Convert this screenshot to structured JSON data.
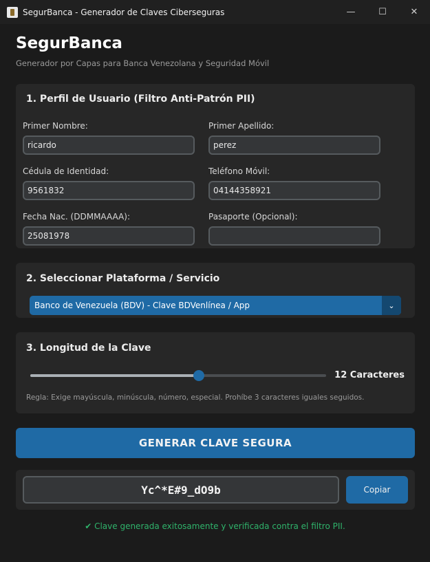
{
  "window": {
    "title": "SegurBanca - Generador de Claves Ciberseguras",
    "minimize_glyph": "—",
    "maximize_glyph": "☐",
    "close_glyph": "✕"
  },
  "header": {
    "title": "SegurBanca",
    "subtitle": "Generador por Capas para Banca Venezolana y Seguridad Móvil"
  },
  "profile": {
    "title": "1. Perfil de Usuario (Filtro Anti-Patrón PII)",
    "fields": [
      {
        "label": "Primer Nombre:",
        "value": "ricardo"
      },
      {
        "label": "Primer Apellido:",
        "value": "perez"
      },
      {
        "label": "Cédula de Identidad:",
        "value": "9561832"
      },
      {
        "label": "Teléfono Móvil:",
        "value": "04144358921"
      },
      {
        "label": "Fecha Nac. (DDMMAAAA):",
        "value": "25081978"
      },
      {
        "label": "Pasaporte (Opcional):",
        "value": ""
      }
    ]
  },
  "platform": {
    "title": "2. Seleccionar Plataforma / Servicio",
    "selected": "Banco de Venezuela (BDV) - Clave BDVenlínea / App",
    "arrow_glyph": "⌄"
  },
  "length": {
    "title": "3. Longitud de la Clave",
    "value_label": "12 Caracteres",
    "slider_fraction": 0.57,
    "rule": "Regla: Exige mayúscula, minúscula, número, especial. Prohíbe 3 caracteres iguales seguidos."
  },
  "actions": {
    "generate_label": "GENERAR CLAVE SEGURA",
    "copy_label": "Copiar"
  },
  "result": {
    "password": "Yc^*E#9_dO9b",
    "status": "✔ Clave generada exitosamente y verificada contra el filtro PII."
  },
  "colors": {
    "accent": "#1f6aa5",
    "success": "#2fb36b",
    "background": "#1b1b1b",
    "card": "#272727"
  }
}
